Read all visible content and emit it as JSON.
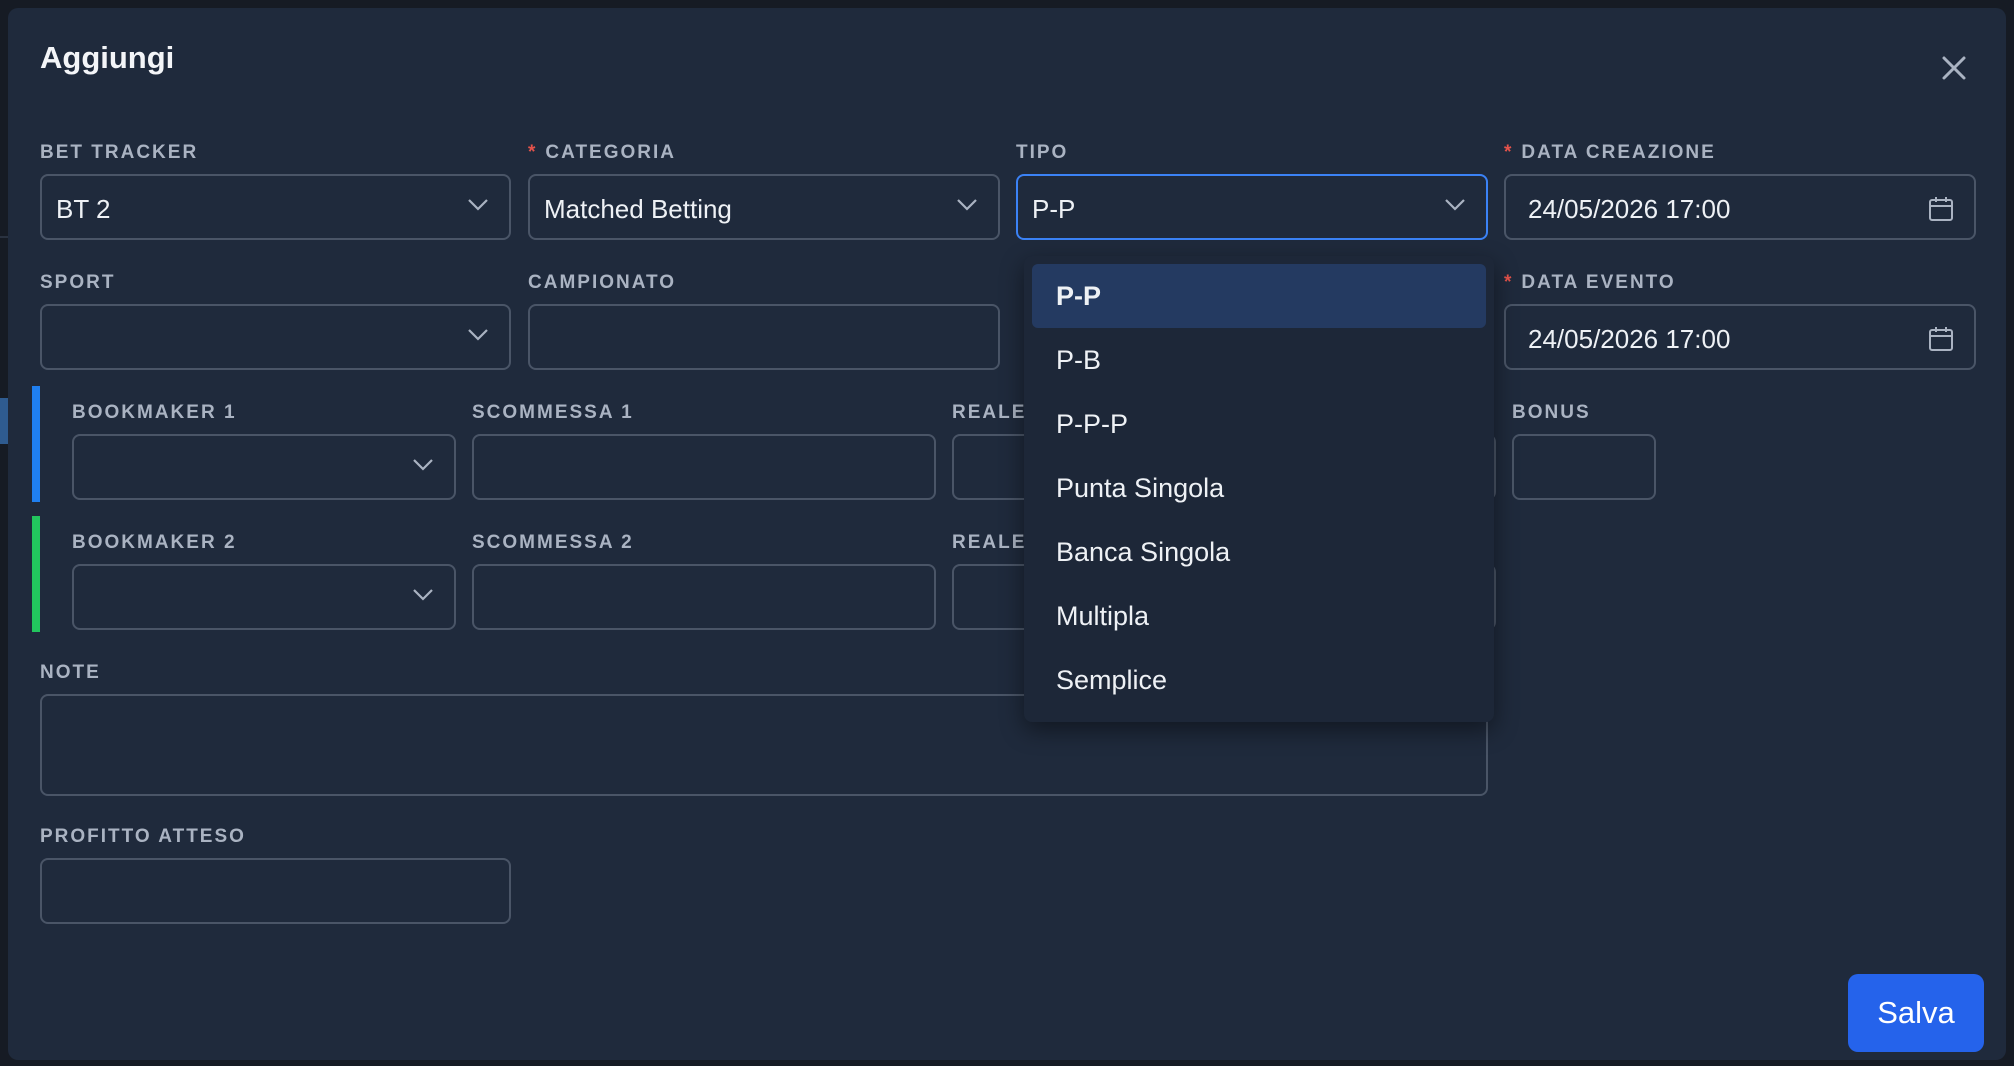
{
  "modal": {
    "title": "Aggiungi",
    "save_label": "Salva"
  },
  "fields": {
    "bet_tracker": {
      "label": "BET TRACKER",
      "value": "BT 2"
    },
    "categoria": {
      "label": "CATEGORIA",
      "value": "Matched Betting",
      "required_mark": "*"
    },
    "tipo": {
      "label": "TIPO",
      "value": "P-P"
    },
    "data_creazione": {
      "label": "DATA CREAZIONE",
      "value": "24/05/2026 17:00",
      "required_mark": "*"
    },
    "sport": {
      "label": "SPORT",
      "value": ""
    },
    "campionato": {
      "label": "CAMPIONATO",
      "value": ""
    },
    "data_evento": {
      "label": "DATA EVENTO",
      "value": "24/05/2026 17:00",
      "required_mark": "*"
    },
    "bookmaker_1": {
      "label": "BOOKMAKER 1",
      "value": ""
    },
    "scommessa_1": {
      "label": "SCOMMESSA 1",
      "value": ""
    },
    "reale_1": {
      "label": "REALE",
      "value": ""
    },
    "bonus": {
      "label": "BONUS",
      "value": ""
    },
    "bookmaker_2": {
      "label": "BOOKMAKER 2",
      "value": ""
    },
    "scommessa_2": {
      "label": "SCOMMESSA 2",
      "value": ""
    },
    "reale_2": {
      "label": "REALE",
      "value": ""
    },
    "note": {
      "label": "NOTE",
      "value": ""
    },
    "profitto_atteso": {
      "label": "PROFITTO ATTESO",
      "value": ""
    }
  },
  "tipo_dropdown": {
    "selected": "P-P",
    "options": [
      "P-P",
      "P-B",
      "P-P-P",
      "Punta Singola",
      "Banca Singola",
      "Multipla",
      "Semplice"
    ]
  },
  "colors": {
    "accent_bookmaker_1": "#1f7ff0",
    "accent_bookmaker_2": "#22c55e",
    "primary": "#2563eb",
    "required": "#e5534b"
  }
}
